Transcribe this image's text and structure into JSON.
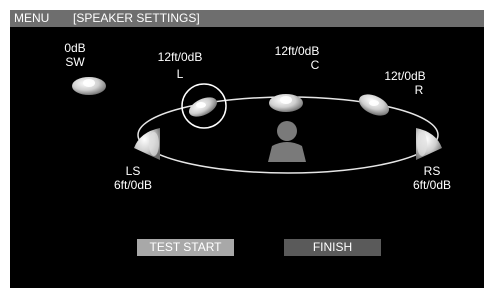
{
  "titlebar": {
    "menu": "MENU",
    "title": "[SPEAKER SETTINGS]"
  },
  "speakers": {
    "sw": {
      "level": "0dB",
      "name": "SW"
    },
    "l": {
      "value": "12ft/0dB",
      "name": "L"
    },
    "c": {
      "value": "12ft/0dB",
      "name": "C"
    },
    "r": {
      "value": "12t/0dB",
      "name": "R"
    },
    "ls": {
      "name": "LS",
      "value": "6ft/0dB"
    },
    "rs": {
      "name": "RS",
      "value": "6ft/0dB"
    }
  },
  "selected_speaker": "L",
  "buttons": {
    "test_start": "TEST START",
    "finish": "FINISH"
  },
  "colors": {
    "title_bar": "#6e6e6e",
    "test_button": "#a8a8a8",
    "finish_button": "#5a5a5a"
  }
}
